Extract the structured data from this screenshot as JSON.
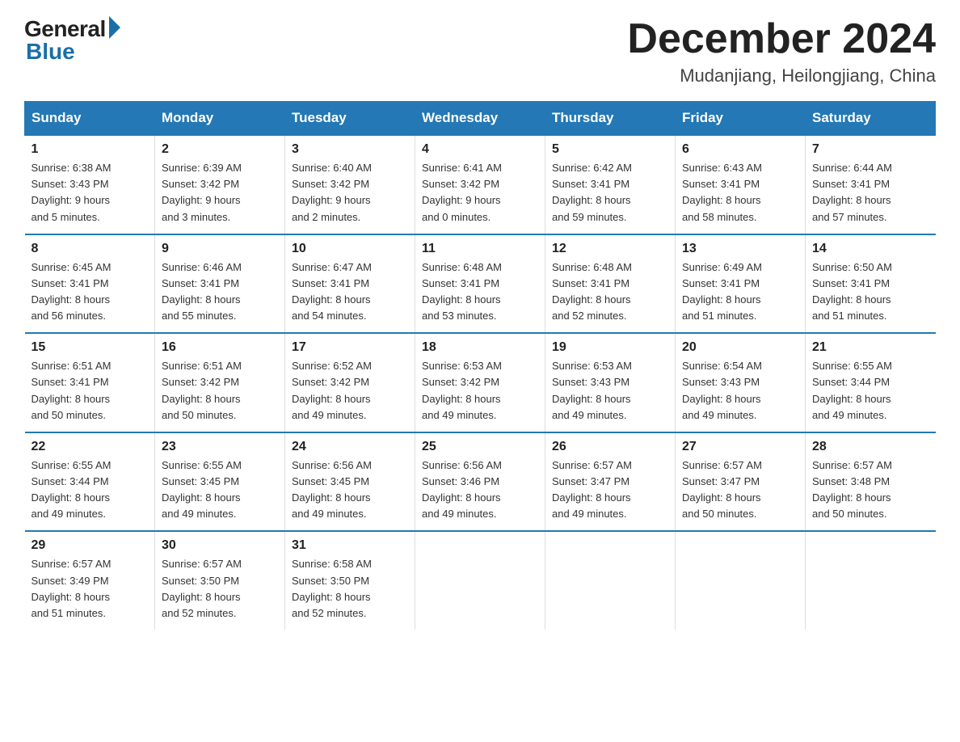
{
  "logo": {
    "text_general": "General",
    "text_blue": "Blue"
  },
  "title": {
    "month": "December 2024",
    "location": "Mudanjiang, Heilongjiang, China"
  },
  "header_days": [
    "Sunday",
    "Monday",
    "Tuesday",
    "Wednesday",
    "Thursday",
    "Friday",
    "Saturday"
  ],
  "weeks": [
    [
      {
        "day": "1",
        "info": "Sunrise: 6:38 AM\nSunset: 3:43 PM\nDaylight: 9 hours\nand 5 minutes."
      },
      {
        "day": "2",
        "info": "Sunrise: 6:39 AM\nSunset: 3:42 PM\nDaylight: 9 hours\nand 3 minutes."
      },
      {
        "day": "3",
        "info": "Sunrise: 6:40 AM\nSunset: 3:42 PM\nDaylight: 9 hours\nand 2 minutes."
      },
      {
        "day": "4",
        "info": "Sunrise: 6:41 AM\nSunset: 3:42 PM\nDaylight: 9 hours\nand 0 minutes."
      },
      {
        "day": "5",
        "info": "Sunrise: 6:42 AM\nSunset: 3:41 PM\nDaylight: 8 hours\nand 59 minutes."
      },
      {
        "day": "6",
        "info": "Sunrise: 6:43 AM\nSunset: 3:41 PM\nDaylight: 8 hours\nand 58 minutes."
      },
      {
        "day": "7",
        "info": "Sunrise: 6:44 AM\nSunset: 3:41 PM\nDaylight: 8 hours\nand 57 minutes."
      }
    ],
    [
      {
        "day": "8",
        "info": "Sunrise: 6:45 AM\nSunset: 3:41 PM\nDaylight: 8 hours\nand 56 minutes."
      },
      {
        "day": "9",
        "info": "Sunrise: 6:46 AM\nSunset: 3:41 PM\nDaylight: 8 hours\nand 55 minutes."
      },
      {
        "day": "10",
        "info": "Sunrise: 6:47 AM\nSunset: 3:41 PM\nDaylight: 8 hours\nand 54 minutes."
      },
      {
        "day": "11",
        "info": "Sunrise: 6:48 AM\nSunset: 3:41 PM\nDaylight: 8 hours\nand 53 minutes."
      },
      {
        "day": "12",
        "info": "Sunrise: 6:48 AM\nSunset: 3:41 PM\nDaylight: 8 hours\nand 52 minutes."
      },
      {
        "day": "13",
        "info": "Sunrise: 6:49 AM\nSunset: 3:41 PM\nDaylight: 8 hours\nand 51 minutes."
      },
      {
        "day": "14",
        "info": "Sunrise: 6:50 AM\nSunset: 3:41 PM\nDaylight: 8 hours\nand 51 minutes."
      }
    ],
    [
      {
        "day": "15",
        "info": "Sunrise: 6:51 AM\nSunset: 3:41 PM\nDaylight: 8 hours\nand 50 minutes."
      },
      {
        "day": "16",
        "info": "Sunrise: 6:51 AM\nSunset: 3:42 PM\nDaylight: 8 hours\nand 50 minutes."
      },
      {
        "day": "17",
        "info": "Sunrise: 6:52 AM\nSunset: 3:42 PM\nDaylight: 8 hours\nand 49 minutes."
      },
      {
        "day": "18",
        "info": "Sunrise: 6:53 AM\nSunset: 3:42 PM\nDaylight: 8 hours\nand 49 minutes."
      },
      {
        "day": "19",
        "info": "Sunrise: 6:53 AM\nSunset: 3:43 PM\nDaylight: 8 hours\nand 49 minutes."
      },
      {
        "day": "20",
        "info": "Sunrise: 6:54 AM\nSunset: 3:43 PM\nDaylight: 8 hours\nand 49 minutes."
      },
      {
        "day": "21",
        "info": "Sunrise: 6:55 AM\nSunset: 3:44 PM\nDaylight: 8 hours\nand 49 minutes."
      }
    ],
    [
      {
        "day": "22",
        "info": "Sunrise: 6:55 AM\nSunset: 3:44 PM\nDaylight: 8 hours\nand 49 minutes."
      },
      {
        "day": "23",
        "info": "Sunrise: 6:55 AM\nSunset: 3:45 PM\nDaylight: 8 hours\nand 49 minutes."
      },
      {
        "day": "24",
        "info": "Sunrise: 6:56 AM\nSunset: 3:45 PM\nDaylight: 8 hours\nand 49 minutes."
      },
      {
        "day": "25",
        "info": "Sunrise: 6:56 AM\nSunset: 3:46 PM\nDaylight: 8 hours\nand 49 minutes."
      },
      {
        "day": "26",
        "info": "Sunrise: 6:57 AM\nSunset: 3:47 PM\nDaylight: 8 hours\nand 49 minutes."
      },
      {
        "day": "27",
        "info": "Sunrise: 6:57 AM\nSunset: 3:47 PM\nDaylight: 8 hours\nand 50 minutes."
      },
      {
        "day": "28",
        "info": "Sunrise: 6:57 AM\nSunset: 3:48 PM\nDaylight: 8 hours\nand 50 minutes."
      }
    ],
    [
      {
        "day": "29",
        "info": "Sunrise: 6:57 AM\nSunset: 3:49 PM\nDaylight: 8 hours\nand 51 minutes."
      },
      {
        "day": "30",
        "info": "Sunrise: 6:57 AM\nSunset: 3:50 PM\nDaylight: 8 hours\nand 52 minutes."
      },
      {
        "day": "31",
        "info": "Sunrise: 6:58 AM\nSunset: 3:50 PM\nDaylight: 8 hours\nand 52 minutes."
      },
      null,
      null,
      null,
      null
    ]
  ]
}
